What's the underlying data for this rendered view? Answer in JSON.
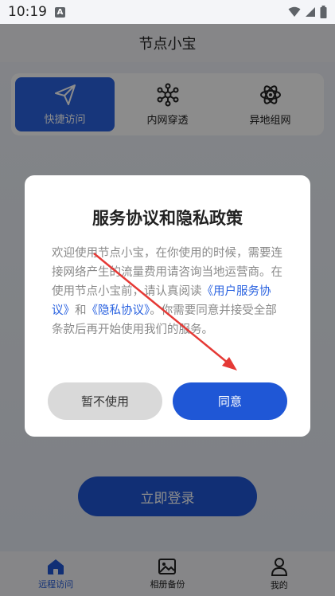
{
  "status": {
    "time": "10:19",
    "notif_letter": "A"
  },
  "appbar": {
    "title": "节点小宝"
  },
  "features": [
    {
      "label": "快捷访问",
      "icon": "send-icon"
    },
    {
      "label": "内网穿透",
      "icon": "network-icon"
    },
    {
      "label": "异地组网",
      "icon": "atom-icon"
    }
  ],
  "login": {
    "label": "立即登录"
  },
  "nav": [
    {
      "label": "远程访问",
      "icon": "home-icon"
    },
    {
      "label": "相册备份",
      "icon": "image-icon"
    },
    {
      "label": "我的",
      "icon": "user-icon"
    }
  ],
  "dialog": {
    "title": "服务协议和隐私政策",
    "body_1": "欢迎使用节点小宝，在你使用的时候，需要连接网络产生的流量费用请咨询当地运营商。在使用节点小宝前，请认真阅读",
    "link_terms": "《用户服务协议》",
    "and": "和",
    "link_privacy": "《隐私协议》",
    "body_2": "。你需要同意并接受全部条款后再开始使用我们的服务。",
    "cancel": "暂不使用",
    "agree": "同意"
  },
  "colors": {
    "accent": "#1f57d6",
    "annotation_arrow": "#e53935"
  }
}
